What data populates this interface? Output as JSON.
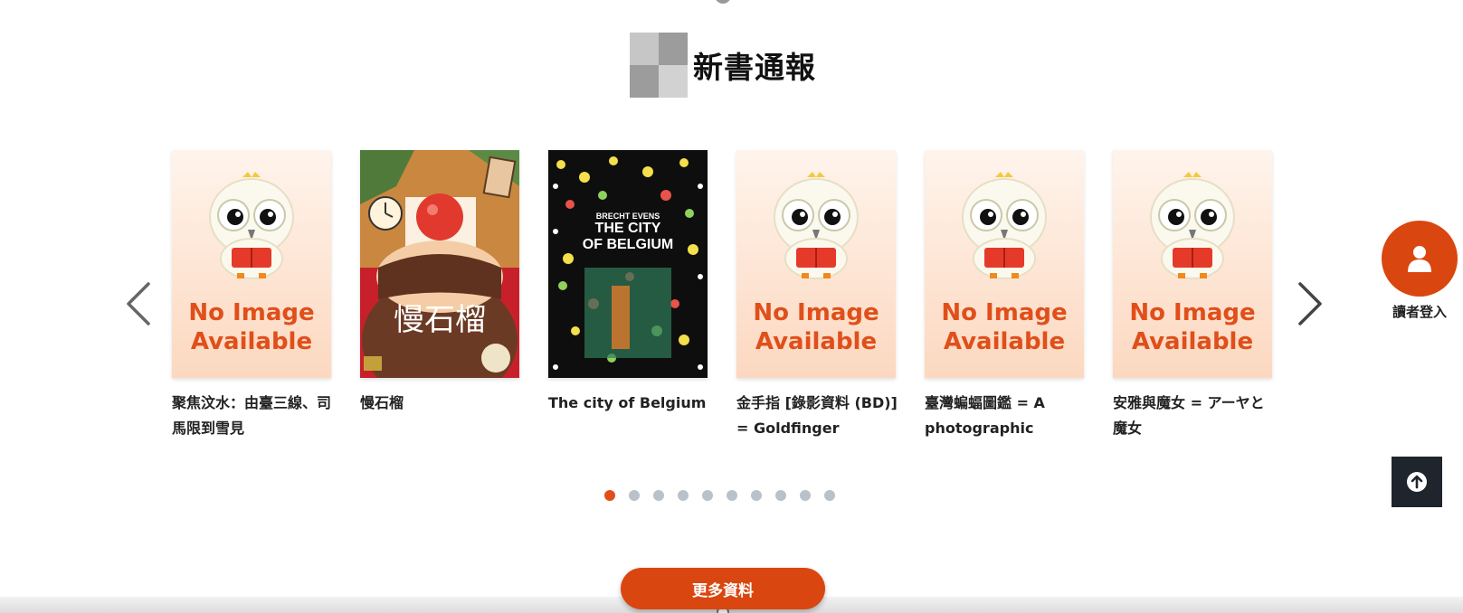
{
  "section": {
    "title": "新書通報"
  },
  "carousel": {
    "no_image_line1": "No Image",
    "no_image_line2": "Available",
    "books": [
      {
        "title": "聚焦汶水：由臺三線、司馬限到雪見",
        "cover": "no-image"
      },
      {
        "title": "慢石榴",
        "cover": "image",
        "cover_text": "慢石榴"
      },
      {
        "title": "The city of Belgium",
        "cover": "image",
        "cover_text_small": "BRECHT EVENS",
        "cover_text_line1": "THE CITY",
        "cover_text_line2": "OF BELGIUM"
      },
      {
        "title": "金手指 [錄影資料 (BD)] = Goldfinger",
        "cover": "no-image"
      },
      {
        "title": "臺灣蝙蝠圖鑑 = A photographic guid...",
        "cover": "no-image"
      },
      {
        "title": "安雅與魔女 = アーヤと魔女",
        "cover": "no-image"
      }
    ],
    "page_count": 10,
    "active_page": 1
  },
  "more_button": {
    "label": "更多資料"
  },
  "login": {
    "label": "讀者登入"
  },
  "colors": {
    "accent": "#d9460f",
    "dot_inactive": "#b9c2ca",
    "dark_button": "#1f252c"
  },
  "icons": {
    "prev": "chevron-left-icon",
    "next": "chevron-right-icon",
    "user": "user-icon",
    "top": "arrow-up-icon"
  }
}
